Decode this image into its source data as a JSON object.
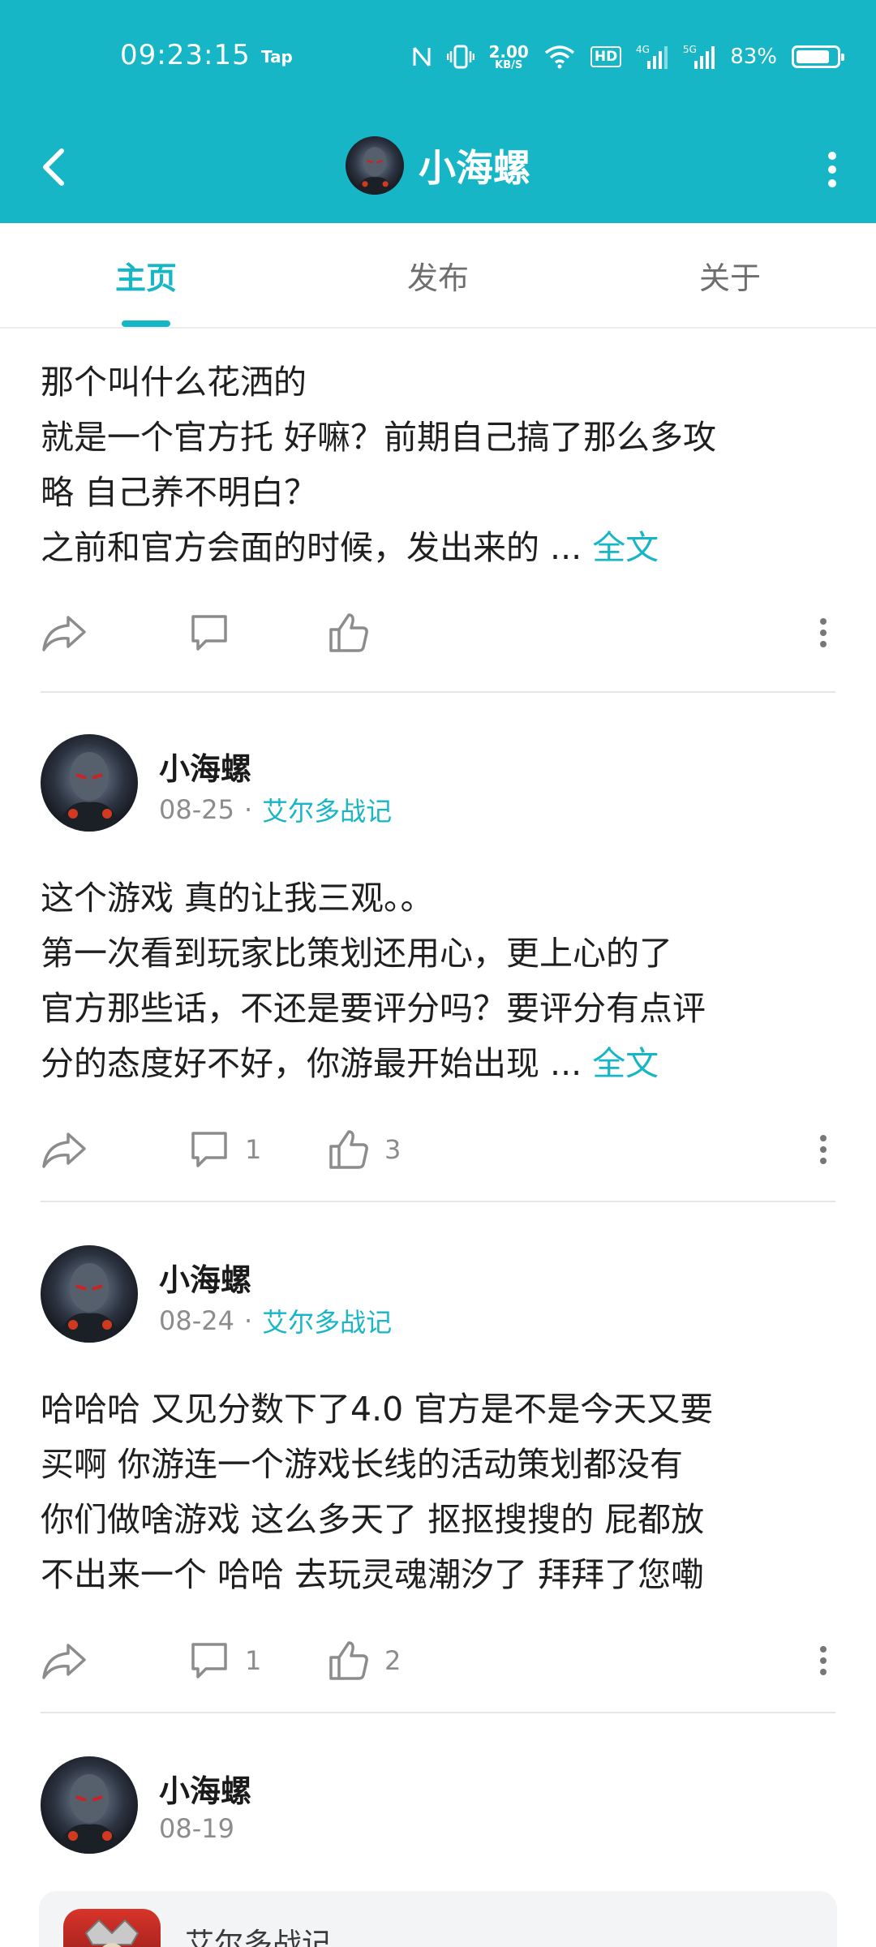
{
  "status_bar": {
    "time": "09:23:15",
    "tap_label": "Tap",
    "net_speed_value": "2.00",
    "net_speed_unit": "KB/S",
    "hd_label": "HD",
    "signal_1_label": "4G",
    "signal_2_label": "5G",
    "battery_percent": "83%",
    "battery_level": 0.83
  },
  "header": {
    "title": "小海螺",
    "back_icon": "chevron-left-icon",
    "more_icon": "more-vertical-icon"
  },
  "tabs": [
    {
      "label": "主页",
      "active": true
    },
    {
      "label": "发布",
      "active": false
    },
    {
      "label": "关于",
      "active": false
    }
  ],
  "colors": {
    "accent": "#17b6c6",
    "meta_gray": "#8c8c8c",
    "divider": "#e6e6e6"
  },
  "posts": [
    {
      "lines": [
        "那个叫什么花洒的",
        "就是一个官方托 好嘛？前期自己搞了那么多攻",
        "略 自己养不明白？",
        "之前和官方会面的时候，发出来的 ..."
      ],
      "more_link": "全文",
      "comments": "",
      "likes": ""
    },
    {
      "author": "小海螺",
      "date": "08-25",
      "separator": "·",
      "game": "艾尔多战记",
      "lines": [
        "这个游戏 真的让我三观。。",
        "第一次看到玩家比策划还用心，更上心的了",
        "官方那些话，不还是要评分吗？要评分有点评",
        "分的态度好不好，你游最开始出现 ..."
      ],
      "more_link": "全文",
      "comments": "1",
      "likes": "3"
    },
    {
      "author": "小海螺",
      "date": "08-24",
      "separator": "·",
      "game": "艾尔多战记",
      "lines": [
        "哈哈哈 又见分数下了4.0 官方是不是今天又要",
        "买啊  你游连一个游戏长线的活动策划都没有",
        "你们做啥游戏 这么多天了 抠抠搜搜的 屁都放",
        "不出来一个  哈哈  去玩灵魂潮汐了  拜拜了您嘞"
      ],
      "more_link": "",
      "comments": "1",
      "likes": "2"
    },
    {
      "author": "小海螺",
      "date": "08-19",
      "game_card": {
        "name": "艾尔多战记"
      }
    }
  ]
}
